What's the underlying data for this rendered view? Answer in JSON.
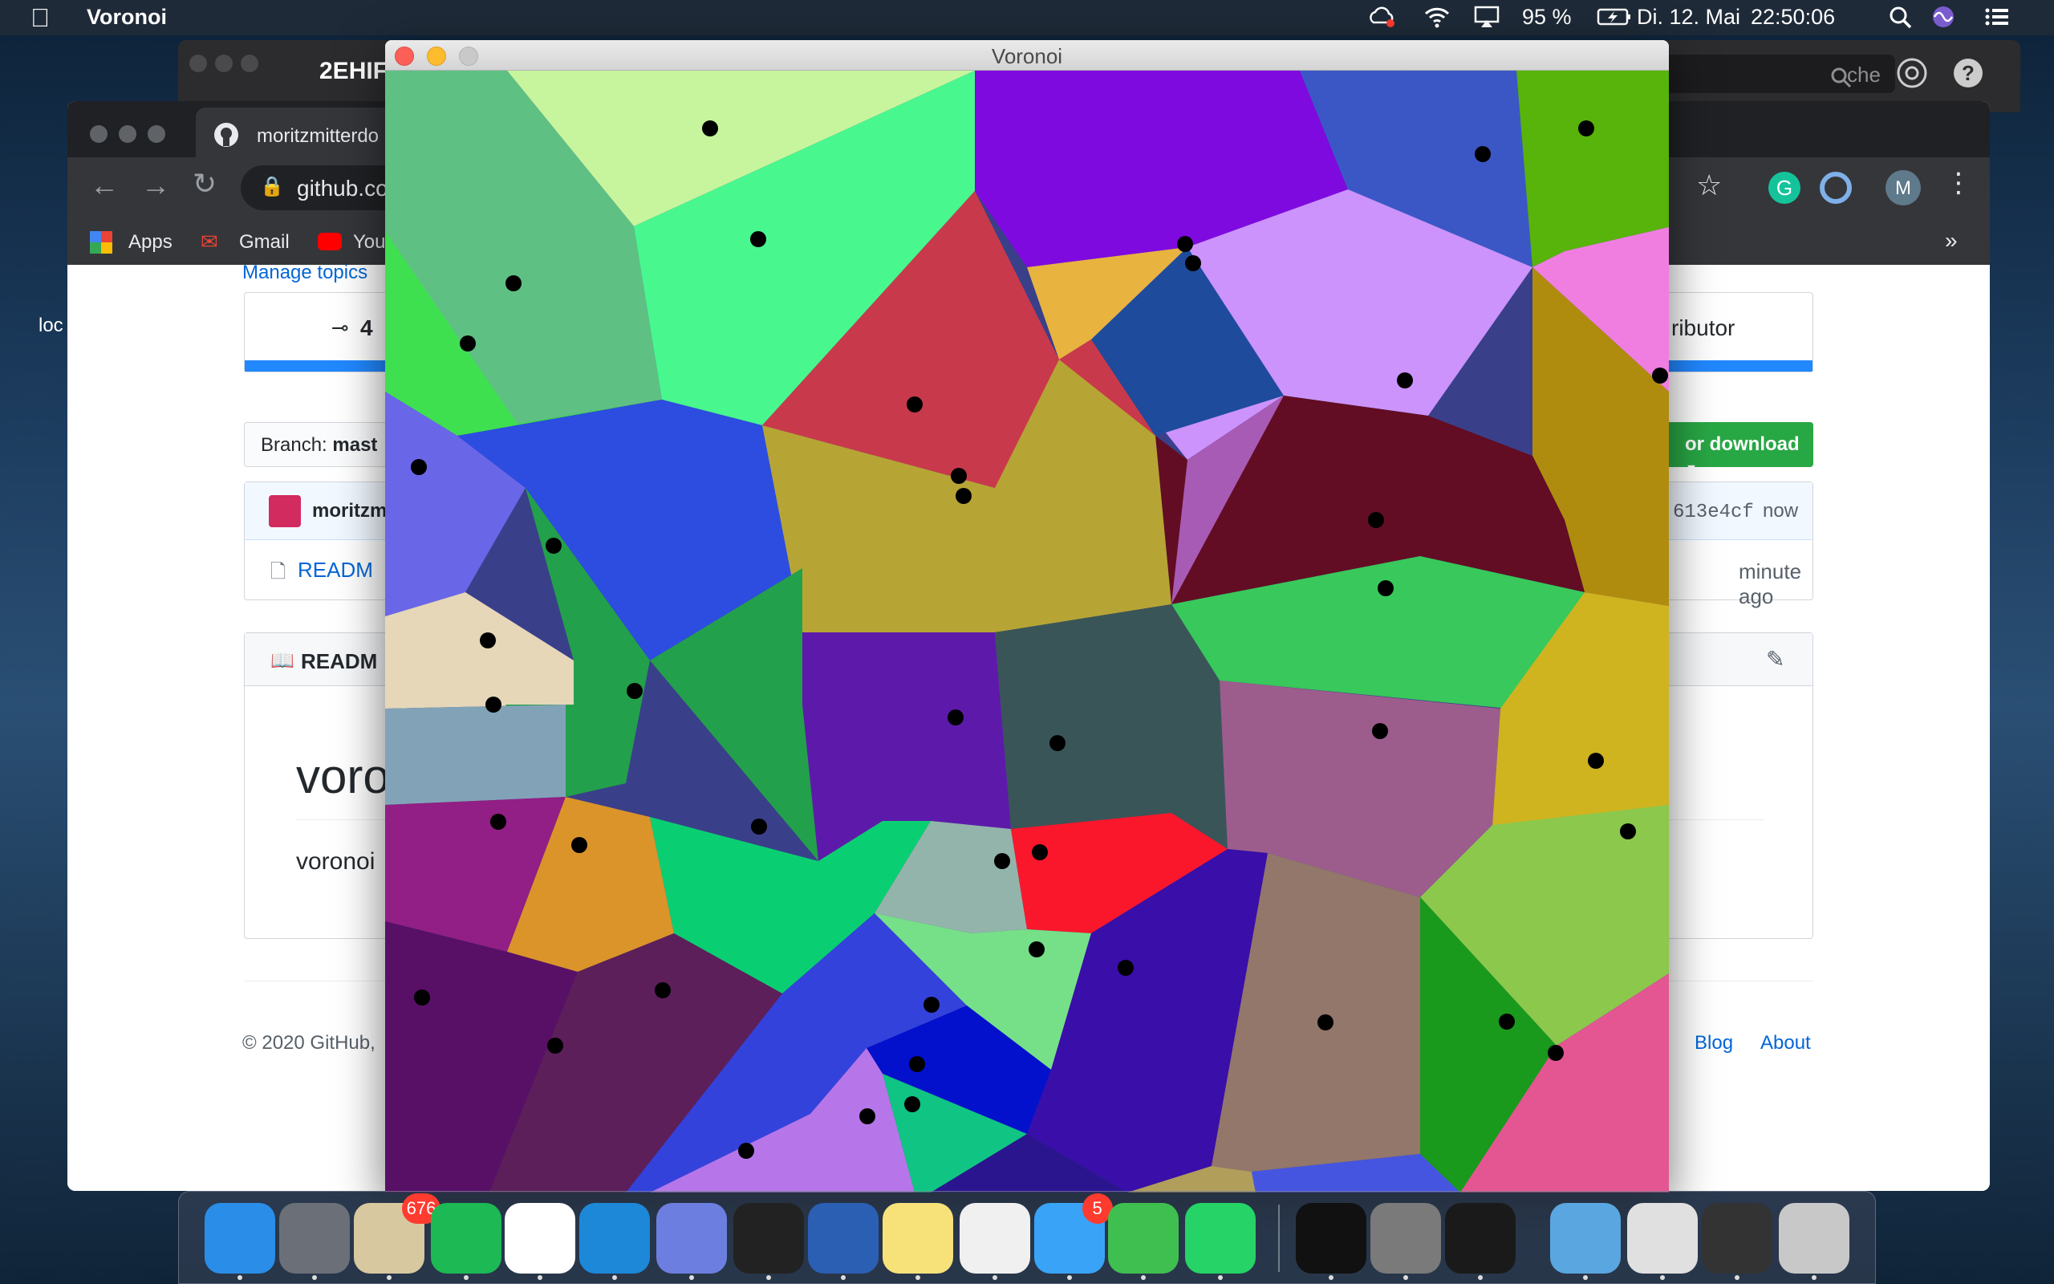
{
  "menubar": {
    "app_name": "Voronoi",
    "battery": "95 %",
    "date": "Di. 12. Mai",
    "time": "22:50:06",
    "icons": [
      "apple-icon",
      "creative-cloud-icon",
      "wifi-icon",
      "airplay-icon",
      "battery-icon",
      "spotlight-icon",
      "siri-icon",
      "control-center-icon"
    ]
  },
  "back_window": {
    "title": "2EHIF",
    "search_placeholder": "che"
  },
  "desktop": {
    "side_label": "loc"
  },
  "github": {
    "tab_title": "moritzmitterdo",
    "url": "github.co",
    "bookmarks": [
      "Apps",
      "Gmail",
      "You"
    ],
    "manage_topics": "Manage topics",
    "commits": "4",
    "contributor": "ributor",
    "branch_label": "Branch:",
    "branch_name": "mast",
    "download_button": "or download",
    "author": "moritzm",
    "commit_hash": "613e4cf",
    "commit_time": "now",
    "readme_file": "READM",
    "file_time": "minute ago",
    "readme_header": "READM",
    "readme_title": "voro",
    "readme_body": "voronoi",
    "footer_copy": "© 2020 GitHub,",
    "footer_links": [
      "Blog",
      "About"
    ]
  },
  "voronoi_window": {
    "title": "Voronoi"
  },
  "dock": {
    "apps": [
      {
        "name": "Finder",
        "color": "#2a8de8"
      },
      {
        "name": "Launchpad",
        "color": "#6b6f78"
      },
      {
        "name": "Mail Bird",
        "color": "#d8c8a0",
        "badge": "676"
      },
      {
        "name": "Spotify",
        "color": "#1db954"
      },
      {
        "name": "Chrome",
        "color": "#ffffff"
      },
      {
        "name": "VS Code",
        "color": "#1e88d8"
      },
      {
        "name": "Discord",
        "color": "#6c7fe0"
      },
      {
        "name": "Terminal",
        "color": "#222222"
      },
      {
        "name": "Word",
        "color": "#2b5fb4"
      },
      {
        "name": "Notes",
        "color": "#f7e27a"
      },
      {
        "name": "Photos",
        "color": "#f0f0f0"
      },
      {
        "name": "Messages",
        "color": "#39a3f7",
        "badge": "5"
      },
      {
        "name": "FaceTime",
        "color": "#3fbf4f"
      },
      {
        "name": "WhatsApp",
        "color": "#25d366"
      },
      {
        "name": "P3",
        "color": "#111111"
      },
      {
        "name": "Calculator",
        "color": "#7a7a7a"
      },
      {
        "name": "Player",
        "color": "#1a1a1a"
      },
      {
        "name": "Folder",
        "color": "#5aa6e0"
      },
      {
        "name": "Document",
        "color": "#e0e0e0"
      },
      {
        "name": "Screen",
        "color": "#333333"
      },
      {
        "name": "Trash",
        "color": "#c8c8c8"
      }
    ]
  }
}
